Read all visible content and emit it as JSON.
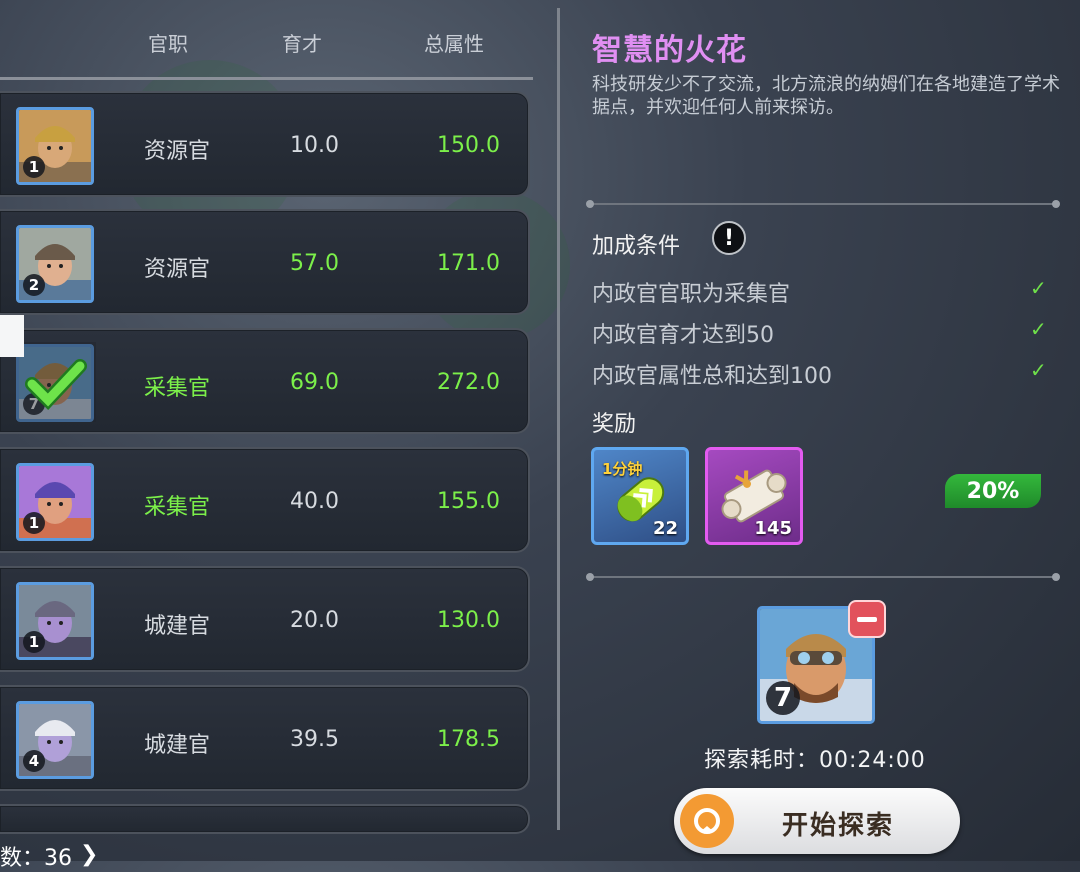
{
  "list": {
    "headers": {
      "role": "官职",
      "talent": "育才",
      "total": "总属性"
    },
    "rows": [
      {
        "level": "1",
        "role": "资源官",
        "talent": "10.0",
        "total": "150.0",
        "role_color": "white",
        "talent_color": "white",
        "selected": false,
        "avatar": "worker-cap"
      },
      {
        "level": "2",
        "role": "资源官",
        "talent": "57.0",
        "total": "171.0",
        "role_color": "white",
        "talent_color": "green",
        "selected": false,
        "avatar": "worker-helmet"
      },
      {
        "level": "7",
        "role": "采集官",
        "talent": "69.0",
        "total": "272.0",
        "role_color": "green",
        "talent_color": "green",
        "selected": true,
        "avatar": "pilot-goggles"
      },
      {
        "level": "1",
        "role": "采集官",
        "talent": "40.0",
        "total": "155.0",
        "role_color": "green",
        "talent_color": "white",
        "selected": false,
        "avatar": "purple-cap-man"
      },
      {
        "level": "1",
        "role": "城建官",
        "talent": "20.0",
        "total": "130.0",
        "role_color": "white",
        "talent_color": "white",
        "selected": false,
        "avatar": "elf-hooded"
      },
      {
        "level": "4",
        "role": "城建官",
        "talent": "39.5",
        "total": "178.5",
        "role_color": "white",
        "talent_color": "white",
        "selected": false,
        "avatar": "elf-white-hood"
      }
    ],
    "footer_count": "数：36"
  },
  "panel": {
    "title": "智慧的火花",
    "description": "科技研发少不了交流，北方流浪的纳姆们在各地建造了学术据点，并欢迎任何人前来探访。",
    "conditions_title": "加成条件",
    "conditions": [
      {
        "text": "内政官官职为采集官",
        "met": true
      },
      {
        "text": "内政官育才达到50",
        "met": true
      },
      {
        "text": "内政官属性总和达到100",
        "met": true
      }
    ],
    "rewards_title": "奖励",
    "rewards": [
      {
        "label": "1分钟",
        "count": "22",
        "icon": "speedup-capsule-icon",
        "rarity": "blue"
      },
      {
        "label": "",
        "count": "145",
        "icon": "scroll-icon",
        "rarity": "purple"
      }
    ],
    "bonus_percent": "20%",
    "assigned": {
      "level": "7",
      "avatar": "pilot-goggles"
    },
    "explore_time": "探索耗时：00:24:00",
    "start_label": "开始探索"
  },
  "colors": {
    "green": "#7cf04a",
    "title_pink": "#e08ff2",
    "frame_blue": "#5b9ce0",
    "bonus_green": "#34b83c"
  }
}
